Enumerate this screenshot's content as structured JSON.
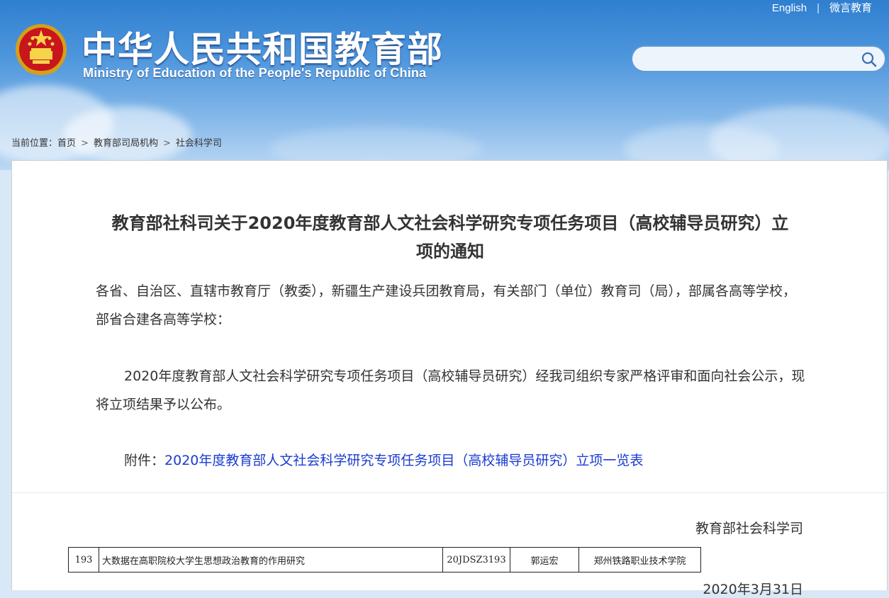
{
  "header": {
    "title_cn": "中华人民共和国教育部",
    "title_en": "Ministry of Education of the People's Republic of China",
    "links": [
      "English",
      "微言教育"
    ],
    "search": {
      "value": "",
      "placeholder": ""
    }
  },
  "breadcrumb": {
    "prefix": "当前位置：",
    "items": [
      "首页",
      "教育部司局机构",
      "社会科学司"
    ]
  },
  "article": {
    "title_line1": "教育部社科司关于2020年度教育部人文社会科学研究专项任务项目（高校辅导员研究）立",
    "title_line2": "项的通知",
    "para1": "各省、自治区、直辖市教育厅（教委），新疆生产建设兵团教育局，有关部门（单位）教育司（局），部属各高等学校，部省合建各高等学校：",
    "para2": "2020年度教育部人文社会科学研究专项任务项目（高校辅导员研究）经我司组织专家严格评审和面向社会公示，现将立项结果予以公布。",
    "attachment_label": "附件：",
    "attachment_link": "2020年度教育部人文社会科学研究专项任务项目（高校辅导员研究）立项一览表",
    "signer": "教育部社会科学司",
    "date": "2020年3月31日"
  },
  "table_row": {
    "cells": [
      "193",
      "大数据在高职院校大学生思想政治教育的作用研究",
      "20JDSZ3193",
      "郭运宏",
      "郑州铁路职业技术学院"
    ]
  },
  "colors": {
    "link": "#1a3bd0",
    "banner": "#4f97dd"
  }
}
